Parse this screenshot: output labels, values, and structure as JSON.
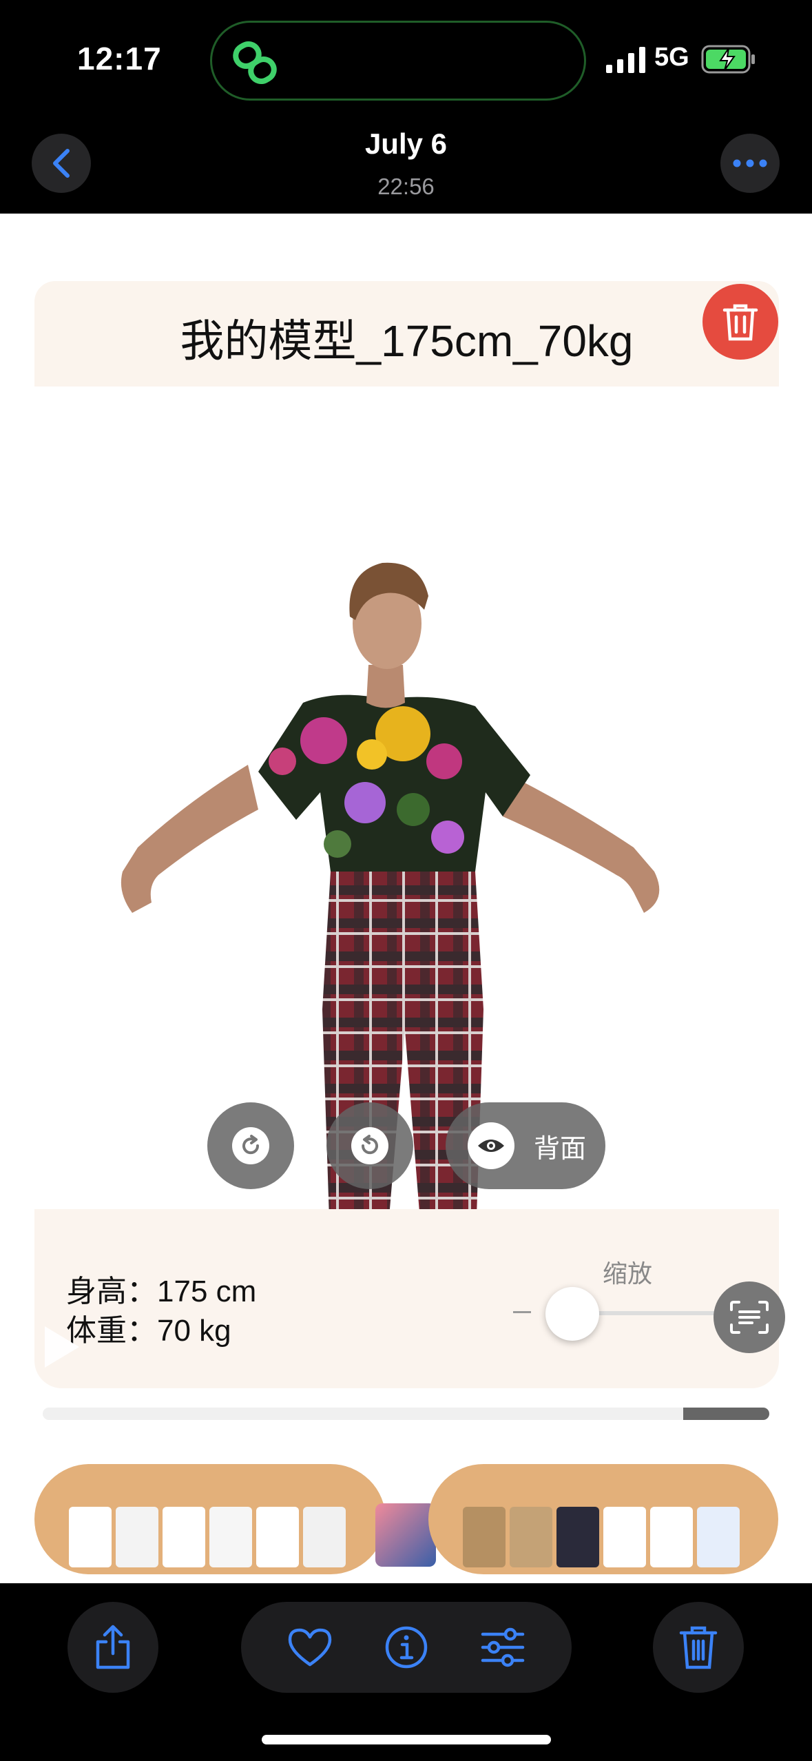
{
  "status_bar": {
    "time": "12:17",
    "network": "5G",
    "icons": [
      "link-icon",
      "signal-bars-icon",
      "battery-charging-icon"
    ]
  },
  "nav": {
    "title": "July 6",
    "subtitle": "22:56",
    "back_icon": "chevron-left-icon",
    "more_icon": "ellipsis-icon"
  },
  "photo": {
    "model_name": "我的模型_175cm_70kg",
    "controls": {
      "rotate_right_icon": "rotate-clockwise-icon",
      "rotate_left_icon": "rotate-counterclockwise-icon",
      "view_toggle_label": "背面"
    },
    "info": {
      "height_line": "身高：175 cm",
      "weight_line": "体重：70 kg",
      "zoom_label": "缩放",
      "zoom_level": 0.1
    },
    "video_progress": 0.88
  },
  "toolbar": {
    "icons": [
      "share-icon",
      "heart-icon",
      "info-icon",
      "adjust-icon",
      "trash-icon"
    ]
  },
  "colors": {
    "accent_blue": "#3b82f6",
    "delete_red": "#e54b3f",
    "panel_beige": "#fbf4ed",
    "strip_tan": "#e3b07a"
  }
}
